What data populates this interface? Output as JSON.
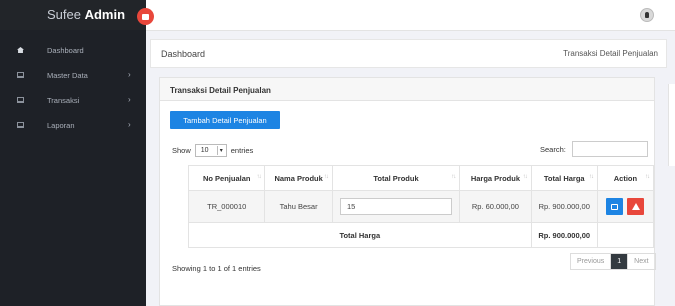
{
  "brand": {
    "light": "Sufee ",
    "bold": "Admin"
  },
  "sidebar": {
    "items": [
      {
        "label": "Dashboard",
        "has_arrow": false
      },
      {
        "label": "Master Data",
        "has_arrow": true
      },
      {
        "label": "Transaksi",
        "has_arrow": true
      },
      {
        "label": "Laporan",
        "has_arrow": true
      }
    ],
    "arrow": "›"
  },
  "breadcrumb": {
    "title": "Dashboard",
    "current": "Transaksi Detail Penjualan"
  },
  "card": {
    "title": "Transaksi Detail Penjualan"
  },
  "add_button": "Tambah Detail Penjualan",
  "length": {
    "show": "Show",
    "value": "10",
    "entries": "entries"
  },
  "search": {
    "label": "Search:",
    "value": ""
  },
  "table": {
    "headers": [
      "No Penjualan",
      "Nama Produk",
      "Total Produk",
      "Harga Produk",
      "Total Harga",
      "Action"
    ],
    "sort_glyph": "↑↓",
    "rows": [
      {
        "no": "TR_000010",
        "produk": "Tahu Besar",
        "total_produk": "15",
        "harga": "Rp. 60.000,00",
        "total_harga": "Rp. 900.000,00"
      }
    ],
    "footer_label": "Total Harga",
    "footer_total": "Rp. 900.000,00"
  },
  "info": "Showing 1 to 1 of 1 entries",
  "pagination": {
    "previous": "Previous",
    "page": "1",
    "next": "Next"
  },
  "colors": {
    "sidebar": "#1e2127",
    "primary": "#1d84e3",
    "danger": "#e8473b"
  }
}
